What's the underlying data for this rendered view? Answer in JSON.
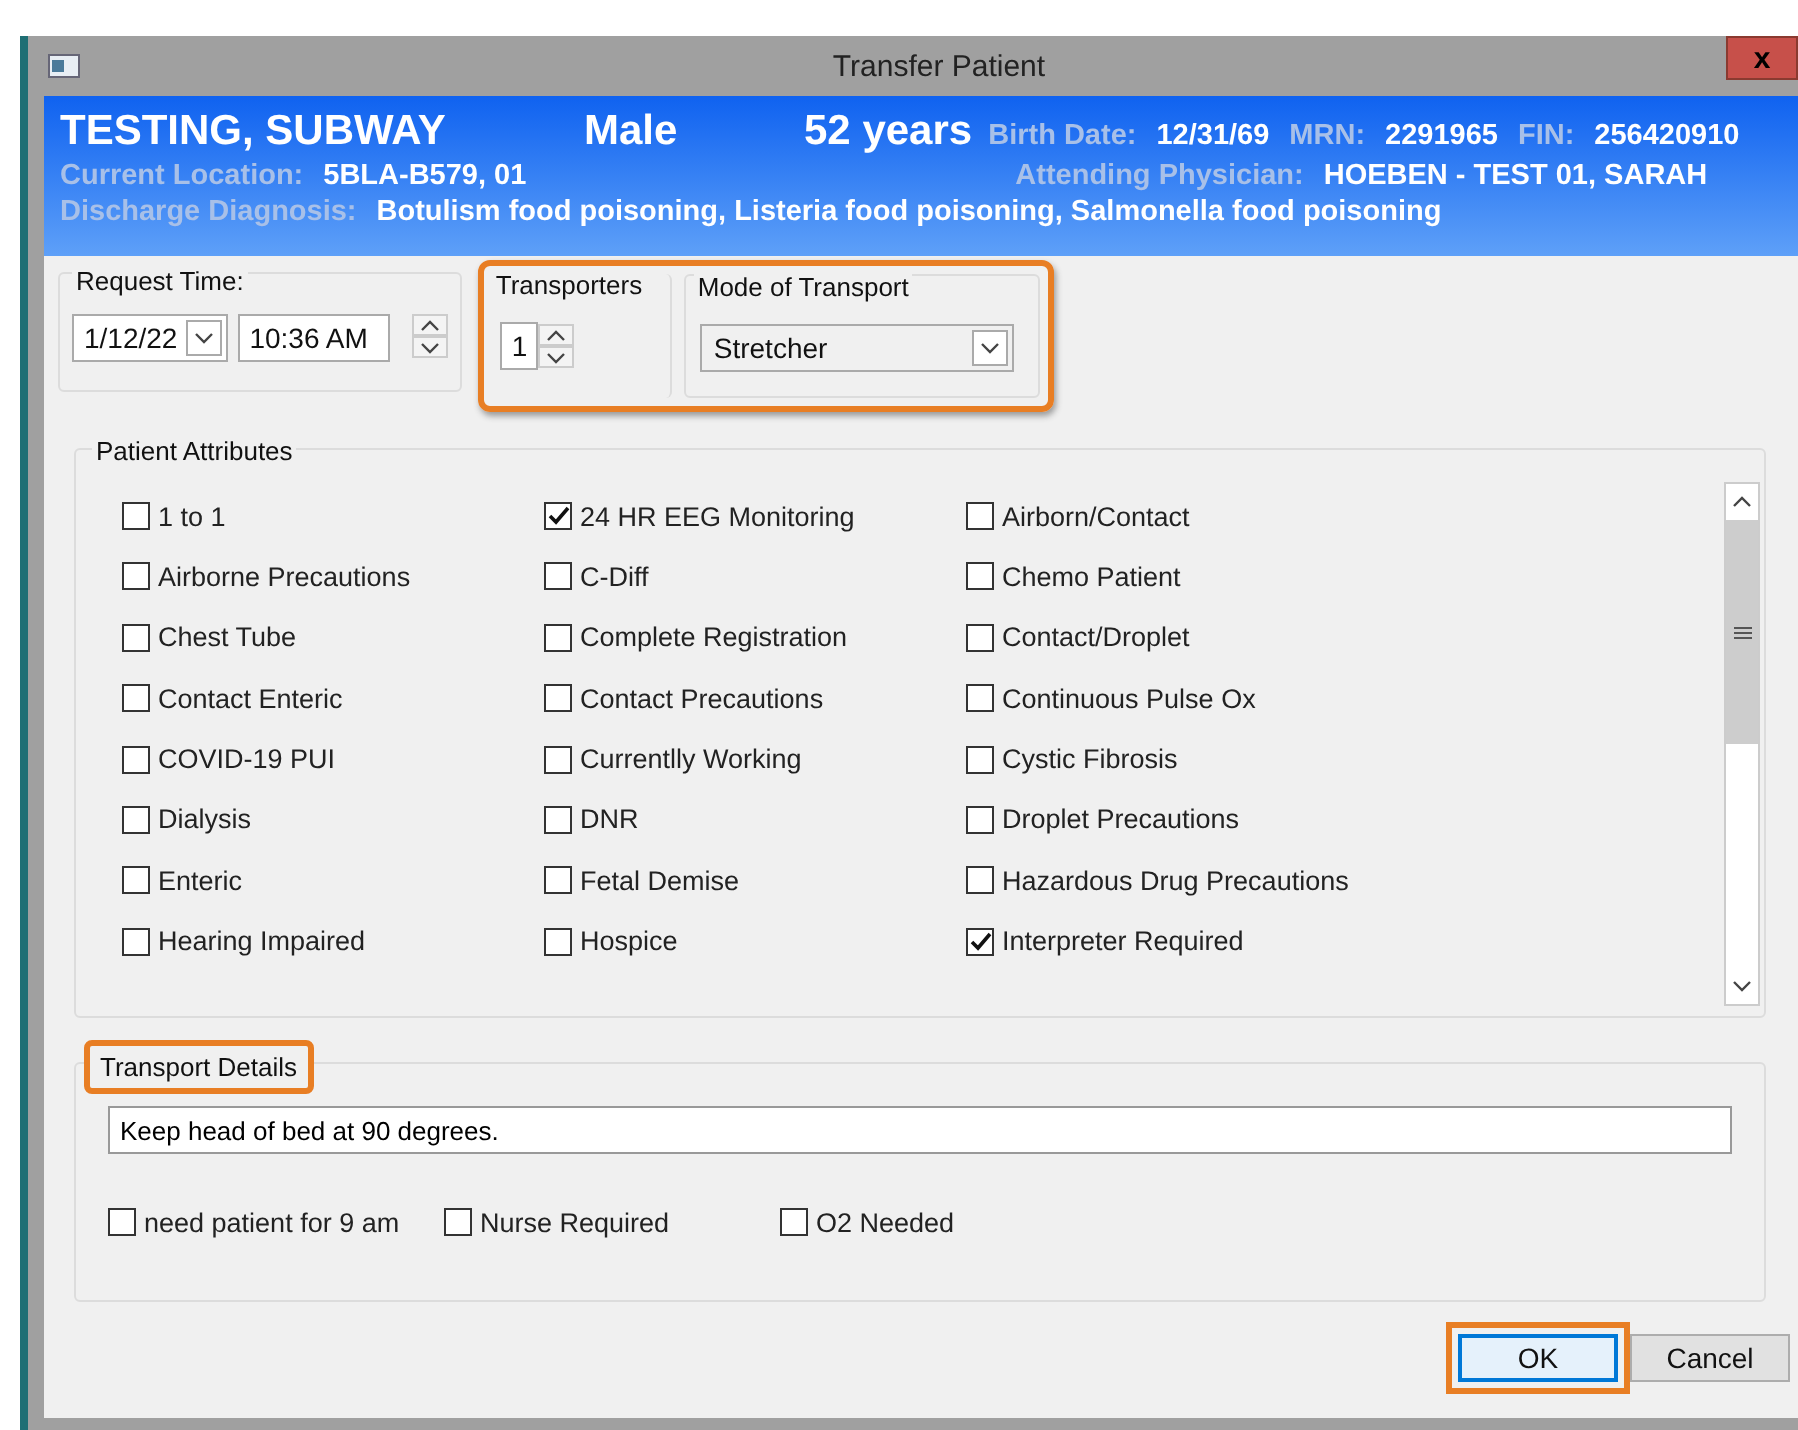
{
  "window": {
    "title": "Transfer Patient",
    "close": "x"
  },
  "header": {
    "name": "TESTING, SUBWAY",
    "sex": "Male",
    "age": "52 years",
    "birth_date_label": "Birth Date:",
    "birth_date": "12/31/69",
    "mrn_label": "MRN:",
    "mrn": "2291965",
    "fin_label": "FIN:",
    "fin": "256420910",
    "location_label": "Current Location:",
    "location": "5BLA-B579, 01",
    "physician_label": "Attending Physician:",
    "physician": "HOEBEN - TEST 01, SARAH",
    "diagnosis_label": "Discharge Diagnosis:",
    "diagnosis": "Botulism food poisoning, Listeria food poisoning, Salmonella food poisoning"
  },
  "request_time": {
    "label": "Request Time:",
    "date": "1/12/22",
    "time": "10:36 AM"
  },
  "transport": {
    "highlighted": true,
    "transporters_label": "Transporters",
    "transporters": "1",
    "mode_label": "Mode of Transport",
    "mode": "Stretcher"
  },
  "patient_attributes": {
    "title": "Patient Attributes",
    "items": [
      {
        "label": "1 to 1",
        "checked": false
      },
      {
        "label": "24 HR EEG Monitoring",
        "checked": true
      },
      {
        "label": "Airborn/Contact",
        "checked": false
      },
      {
        "label": "Airborne Precautions",
        "checked": false
      },
      {
        "label": "C-Diff",
        "checked": false
      },
      {
        "label": "Chemo Patient",
        "checked": false
      },
      {
        "label": "Chest Tube",
        "checked": false
      },
      {
        "label": "Complete Registration",
        "checked": false
      },
      {
        "label": "Contact/Droplet",
        "checked": false
      },
      {
        "label": "Contact Enteric",
        "checked": false
      },
      {
        "label": "Contact Precautions",
        "checked": false
      },
      {
        "label": "Continuous Pulse Ox",
        "checked": false
      },
      {
        "label": "COVID-19 PUI",
        "checked": false
      },
      {
        "label": "Currentlly Working",
        "checked": false
      },
      {
        "label": "Cystic Fibrosis",
        "checked": false
      },
      {
        "label": "Dialysis",
        "checked": false
      },
      {
        "label": "DNR",
        "checked": false
      },
      {
        "label": "Droplet Precautions",
        "checked": false
      },
      {
        "label": "Enteric",
        "checked": false
      },
      {
        "label": "Fetal Demise",
        "checked": false
      },
      {
        "label": "Hazardous Drug Precautions",
        "checked": false
      },
      {
        "label": "Hearing Impaired",
        "checked": false
      },
      {
        "label": "Hospice",
        "checked": false
      },
      {
        "label": "Interpreter Required",
        "checked": true
      }
    ]
  },
  "transport_details": {
    "title": "Transport Details",
    "title_highlighted": true,
    "value": "Keep head of bed at 90 degrees.",
    "options": [
      {
        "label": "need patient for 9 am",
        "checked": false
      },
      {
        "label": "Nurse Required",
        "checked": false
      },
      {
        "label": "O2 Needed",
        "checked": false
      }
    ]
  },
  "buttons": [
    {
      "label": "OK",
      "selected": true,
      "highlighted": true
    },
    {
      "label": "Cancel",
      "selected": false,
      "highlighted": false
    }
  ]
}
